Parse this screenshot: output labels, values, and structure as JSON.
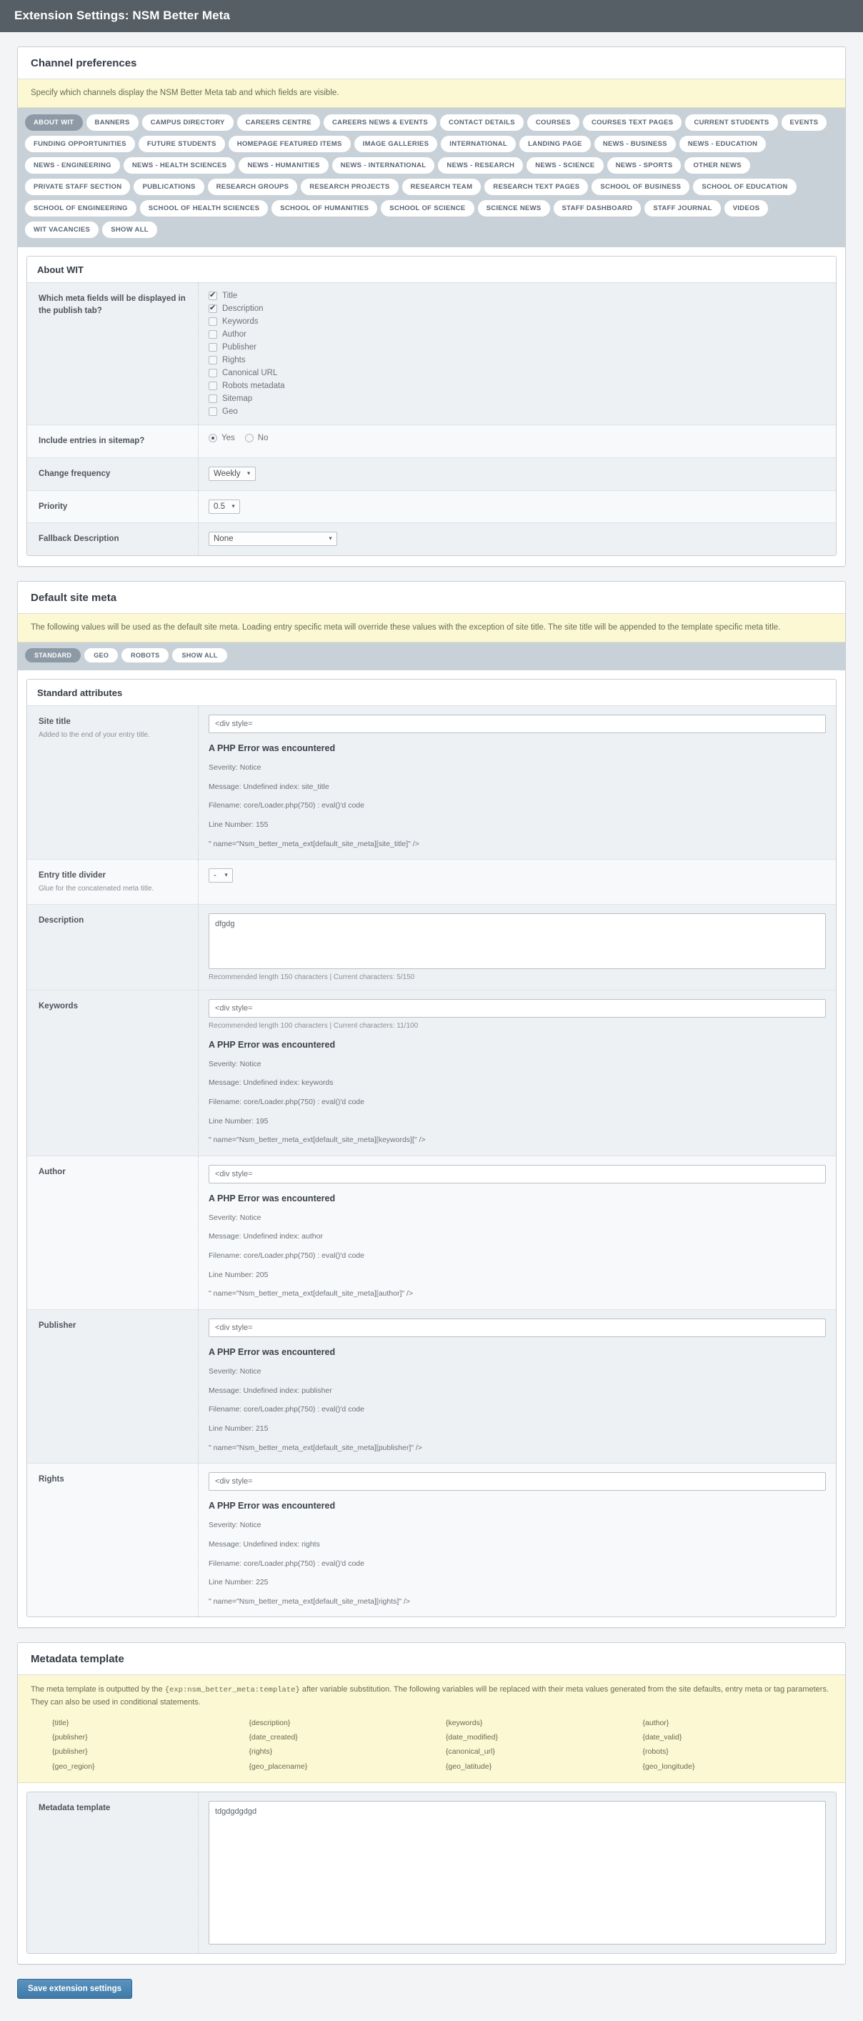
{
  "titlebar": {
    "title": "Extension Settings: NSM Better Meta"
  },
  "channel_prefs": {
    "heading": "Channel preferences",
    "note": "Specify which channels display the NSM Better Meta tab and which fields are visible.",
    "channels": [
      "ABOUT WIT",
      "BANNERS",
      "CAMPUS DIRECTORY",
      "CAREERS CENTRE",
      "CAREERS NEWS & EVENTS",
      "CONTACT DETAILS",
      "COURSES",
      "COURSES TEXT PAGES",
      "CURRENT STUDENTS",
      "EVENTS",
      "FUNDING OPPORTUNITIES",
      "FUTURE STUDENTS",
      "HOMEPAGE FEATURED ITEMS",
      "IMAGE GALLERIES",
      "INTERNATIONAL",
      "LANDING PAGE",
      "NEWS - BUSINESS",
      "NEWS - EDUCATION",
      "NEWS - ENGINEERING",
      "NEWS - HEALTH SCIENCES",
      "NEWS - HUMANITIES",
      "NEWS - INTERNATIONAL",
      "NEWS - RESEARCH",
      "NEWS - SCIENCE",
      "NEWS - SPORTS",
      "OTHER NEWS",
      "PRIVATE STAFF SECTION",
      "PUBLICATIONS",
      "RESEARCH GROUPS",
      "RESEARCH PROJECTS",
      "RESEARCH TEAM",
      "RESEARCH TEXT PAGES",
      "SCHOOL OF BUSINESS",
      "SCHOOL OF EDUCATION",
      "SCHOOL OF ENGINEERING",
      "SCHOOL OF HEALTH SCIENCES",
      "SCHOOL OF HUMANITIES",
      "SCHOOL OF SCIENCE",
      "SCIENCE NEWS",
      "STAFF DASHBOARD",
      "STAFF JOURNAL",
      "VIDEOS",
      "WIT VACANCIES",
      "SHOW ALL"
    ],
    "active_channel": "ABOUT WIT",
    "card_title": "About WIT",
    "meta_fields_label": "Which meta fields will be displayed in the publish tab?",
    "meta_fields": [
      {
        "label": "Title",
        "checked": true
      },
      {
        "label": "Description",
        "checked": true
      },
      {
        "label": "Keywords",
        "checked": false
      },
      {
        "label": "Author",
        "checked": false
      },
      {
        "label": "Publisher",
        "checked": false
      },
      {
        "label": "Rights",
        "checked": false
      },
      {
        "label": "Canonical URL",
        "checked": false
      },
      {
        "label": "Robots metadata",
        "checked": false
      },
      {
        "label": "Sitemap",
        "checked": false
      },
      {
        "label": "Geo",
        "checked": false
      }
    ],
    "sitemap_label": "Include entries in sitemap?",
    "sitemap_yes": "Yes",
    "sitemap_no": "No",
    "sitemap_value": "Yes",
    "change_frequency_label": "Change frequency",
    "change_frequency_value": "Weekly",
    "priority_label": "Priority",
    "priority_value": "0.5",
    "fallback_label": "Fallback Description",
    "fallback_value": "None"
  },
  "site_meta": {
    "heading": "Default site meta",
    "note": "The following values will be used as the default site meta. Loading entry specific meta will override these values with the exception of site title. The site title will be appended to the template specific meta title.",
    "tabs": [
      "STANDARD",
      "GEO",
      "ROBOTS",
      "SHOW ALL"
    ],
    "active_tab": "STANDARD",
    "card_title": "Standard attributes",
    "rows": [
      {
        "label": "Site title",
        "sub": "Added to the end of your entry title.",
        "input_value": "<div style=",
        "error": {
          "heading": "A PHP Error was encountered",
          "severity": "Severity: Notice",
          "message": "Message: Undefined index: site_title",
          "filename": "Filename: core/Loader.php(750) : eval()'d code",
          "line": "Line Number: 155",
          "tail": "\" name=\"Nsm_better_meta_ext[default_site_meta][site_title]\" />"
        }
      },
      {
        "label": "Keywords",
        "sub": "",
        "input_value": "<div style=",
        "hint": "Recommended length 100 characters | Current characters: 11/100",
        "error": {
          "heading": "A PHP Error was encountered",
          "severity": "Severity: Notice",
          "message": "Message: Undefined index: keywords",
          "filename": "Filename: core/Loader.php(750) : eval()'d code",
          "line": "Line Number: 195",
          "tail": "\" name=\"Nsm_better_meta_ext[default_site_meta][keywords][\" />"
        }
      },
      {
        "label": "Author",
        "sub": "",
        "input_value": "<div style=",
        "error": {
          "heading": "A PHP Error was encountered",
          "severity": "Severity: Notice",
          "message": "Message: Undefined index: author",
          "filename": "Filename: core/Loader.php(750) : eval()'d code",
          "line": "Line Number: 205",
          "tail": "\" name=\"Nsm_better_meta_ext[default_site_meta][author]\" />"
        }
      },
      {
        "label": "Publisher",
        "sub": "",
        "input_value": "<div style=",
        "error": {
          "heading": "A PHP Error was encountered",
          "severity": "Severity: Notice",
          "message": "Message: Undefined index: publisher",
          "filename": "Filename: core/Loader.php(750) : eval()'d code",
          "line": "Line Number: 215",
          "tail": "\" name=\"Nsm_better_meta_ext[default_site_meta][publisher]\" />"
        }
      },
      {
        "label": "Rights",
        "sub": "",
        "input_value": "<div style=",
        "error": {
          "heading": "A PHP Error was encountered",
          "severity": "Severity: Notice",
          "message": "Message: Undefined index: rights",
          "filename": "Filename: core/Loader.php(750) : eval()'d code",
          "line": "Line Number: 225",
          "tail": "\" name=\"Nsm_better_meta_ext[default_site_meta][rights]\" />"
        }
      }
    ],
    "divider_label": "Entry title divider",
    "divider_sub": "Glue for the concatenated meta title.",
    "divider_value": "-",
    "description_label": "Description",
    "description_value": "dfgdg",
    "description_hint": "Recommended length 150 characters | Current characters: 5/150"
  },
  "metadata_template": {
    "heading": "Metadata template",
    "note_prefix": "The meta template is outputted by the",
    "note_code": "{exp:nsm_better_meta:template}",
    "note_suffix": "after variable substitution. The following variables will be replaced with their meta values generated from the site defaults, entry meta or tag parameters. They can also be used in conditional statements.",
    "variables": [
      "{title}",
      "{description}",
      "{keywords}",
      "{author}",
      "{publisher}",
      "{date_created}",
      "{date_modified}",
      "{date_valid}",
      "{publisher}",
      "{rights}",
      "{canonical_url}",
      "{robots}",
      "{geo_region}",
      "{geo_placename}",
      "{geo_latitude}",
      "{geo_longitude}"
    ],
    "field_label": "Metadata template",
    "field_value": "tdgdgdgdgd"
  },
  "save_button": "Save extension settings"
}
